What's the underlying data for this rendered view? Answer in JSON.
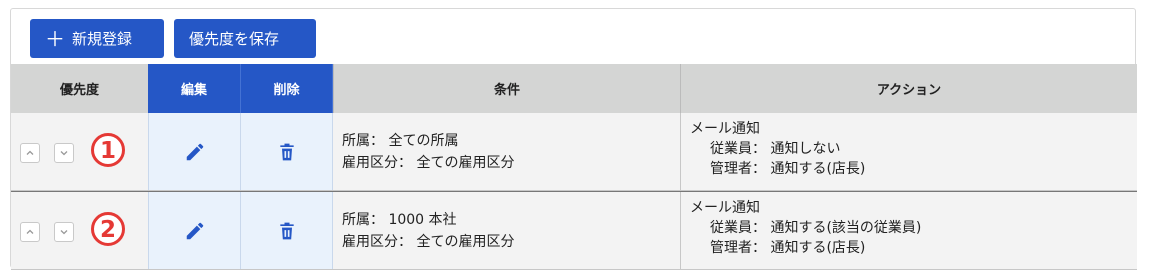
{
  "toolbar": {
    "add_label": "新規登録",
    "add_icon": "plus-icon",
    "save_label": "優先度を保存"
  },
  "colors": {
    "primary": "#2557c6",
    "header_grey": "#d4d5d4",
    "cell_blue": "#e9f2fc",
    "badge_red": "#e53935"
  },
  "table": {
    "headers": {
      "priority": "優先度",
      "edit": "編集",
      "delete": "削除",
      "condition": "条件",
      "action": "アクション"
    },
    "rows": [
      {
        "rank": "1",
        "condition": {
          "line1": "所属： 全ての所属",
          "line2": "雇用区分： 全ての雇用区分"
        },
        "action": {
          "title": "メール通知",
          "employee": "従業員： 通知しない",
          "manager": "管理者： 通知する(店長)"
        }
      },
      {
        "rank": "2",
        "condition": {
          "line1": "所属： 1000 本社",
          "line2": "雇用区分： 全ての雇用区分"
        },
        "action": {
          "title": "メール通知",
          "employee": "従業員： 通知する(該当の従業員)",
          "manager": "管理者： 通知する(店長)"
        }
      }
    ]
  }
}
